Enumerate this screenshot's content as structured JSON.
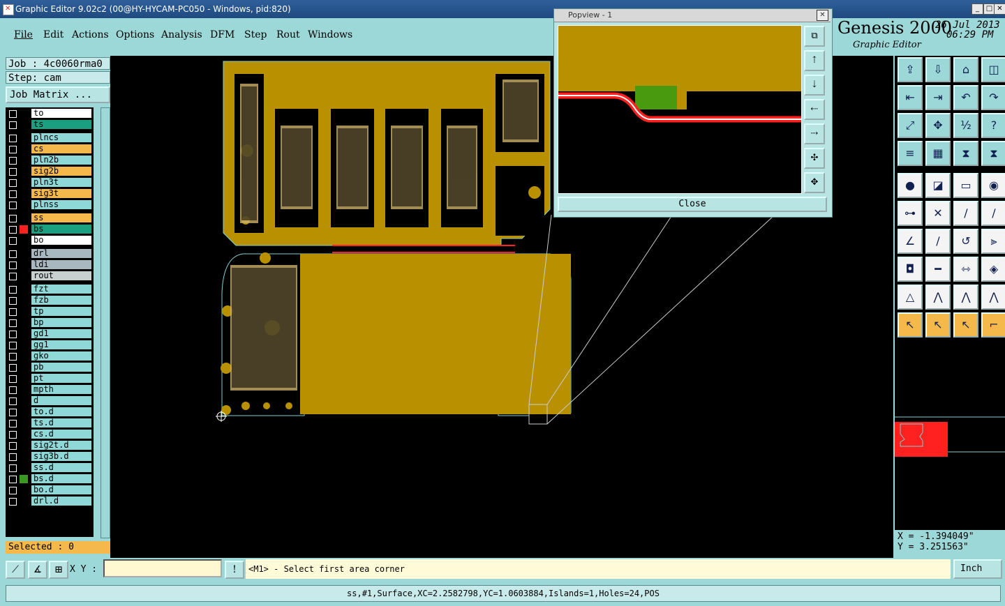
{
  "window": {
    "title": "Graphic Editor 9.02c2 (00@HY-HYCAM-PC050 - Windows, pid:820)",
    "min_label": "_",
    "max_label": "□",
    "close_label": "✕"
  },
  "menu": {
    "file": "File",
    "edit": "Edit",
    "actions": "Actions",
    "options": "Options",
    "analysis": "Analysis",
    "dfm": "DFM",
    "step": "Step",
    "rout": "Rout",
    "windows": "Windows"
  },
  "brand": {
    "name": "Genesis 2000",
    "subtitle": "Graphic Editor",
    "date": "26 Jul 2013",
    "time": "06:29 PM"
  },
  "left": {
    "job": "Job : 4c0060rma0",
    "step": "Step: cam",
    "job_matrix": "Job Matrix ...",
    "selected": "Selected : 0"
  },
  "layers": [
    {
      "name": "to",
      "bg": "#ffffff",
      "marker": ""
    },
    {
      "name": "ts",
      "bg": "#1aa080",
      "marker": ""
    },
    {
      "name": "plncs",
      "bg": "#8fd8d8",
      "marker": ""
    },
    {
      "name": "cs",
      "bg": "#f5b84a",
      "marker": ""
    },
    {
      "name": "pln2b",
      "bg": "#8fd8d8",
      "marker": ""
    },
    {
      "name": "sig2b",
      "bg": "#f5b84a",
      "marker": ""
    },
    {
      "name": "pln3t",
      "bg": "#8fd8d8",
      "marker": ""
    },
    {
      "name": "sig3t",
      "bg": "#f5b84a",
      "marker": ""
    },
    {
      "name": "plnss",
      "bg": "#8fd8d8",
      "marker": ""
    },
    {
      "name": "ss",
      "bg": "#f5b84a",
      "marker": ""
    },
    {
      "name": "bs",
      "bg": "#1aa080",
      "marker": "#ff2020"
    },
    {
      "name": "bo",
      "bg": "#ffffff",
      "marker": ""
    },
    {
      "name": "drl",
      "bg": "#a8b8c0",
      "marker": ""
    },
    {
      "name": "ldi",
      "bg": "#a8b8c0",
      "marker": ""
    },
    {
      "name": "rout",
      "bg": "#c8d0d0",
      "marker": ""
    },
    {
      "name": "fzt",
      "bg": "#8fd8d8",
      "marker": ""
    },
    {
      "name": "fzb",
      "bg": "#8fd8d8",
      "marker": ""
    },
    {
      "name": "tp",
      "bg": "#8fd8d8",
      "marker": ""
    },
    {
      "name": "bp",
      "bg": "#8fd8d8",
      "marker": ""
    },
    {
      "name": "gd1",
      "bg": "#8fd8d8",
      "marker": ""
    },
    {
      "name": "gg1",
      "bg": "#8fd8d8",
      "marker": ""
    },
    {
      "name": "gko",
      "bg": "#8fd8d8",
      "marker": ""
    },
    {
      "name": "pb",
      "bg": "#8fd8d8",
      "marker": ""
    },
    {
      "name": "pt",
      "bg": "#8fd8d8",
      "marker": ""
    },
    {
      "name": "mpth",
      "bg": "#8fd8d8",
      "marker": ""
    },
    {
      "name": "d",
      "bg": "#8fd8d8",
      "marker": ""
    },
    {
      "name": "to.d",
      "bg": "#8fd8d8",
      "marker": ""
    },
    {
      "name": "ts.d",
      "bg": "#8fd8d8",
      "marker": ""
    },
    {
      "name": "cs.d",
      "bg": "#8fd8d8",
      "marker": ""
    },
    {
      "name": "sig2t.d",
      "bg": "#8fd8d8",
      "marker": ""
    },
    {
      "name": "sig3b.d",
      "bg": "#8fd8d8",
      "marker": ""
    },
    {
      "name": "ss.d",
      "bg": "#8fd8d8",
      "marker": ""
    },
    {
      "name": "bs.d",
      "bg": "#8fd8d8",
      "marker": "#3a9a20"
    },
    {
      "name": "bo.d",
      "bg": "#8fd8d8",
      "marker": ""
    },
    {
      "name": "drl.d",
      "bg": "#8fd8d8",
      "marker": ""
    }
  ],
  "popview": {
    "title": "Popview - 1",
    "close_label": "Close",
    "close_x": "✕"
  },
  "bottom": {
    "xy_label": "X Y :",
    "xy_value": "",
    "prompt": "<M1> - Select first area corner",
    "units": "Inch",
    "status": "ss,#1,Surface,XC=2.2582798,YC=1.0603884,Islands=1,Holes=24,POS"
  },
  "coords": {
    "x": "X = -1.394049\"",
    "y": "Y = 3.251563\""
  },
  "colors": {
    "accent": "#9dd8d8",
    "copper": "#b89000",
    "highlight": "#f5b84a",
    "red": "#ff2020"
  },
  "tools": [
    "zoom-home-icon",
    "zoom-in-icon",
    "zoom-house-icon",
    "window-split-icon",
    "pan-left-icon",
    "pan-right-icon",
    "undo-view-icon",
    "redo-view-icon",
    "fit-icon",
    "center-icon",
    "scale-1-2-icon",
    "help-icon",
    "sliders-icon",
    "grid-icon",
    "snap-icon",
    "snap-red-icon",
    "feature-icon",
    "line-color-icon",
    "ruler-icon",
    "dot-icon",
    "node-icon",
    "cross-icon",
    "pad-arc-icon",
    "pad-line-icon",
    "draw-line-icon",
    "draw-line2-icon",
    "arc-icon",
    "flip-icon",
    "pad-add-icon",
    "line-add-icon",
    "measure-icon",
    "shapes-icon",
    "triangle-icon",
    "triangle2-icon",
    "triangle3-icon",
    "triangle4-icon",
    "select-arrow-icon",
    "select-arrow2-icon",
    "select-arrow3-icon",
    "select-route-icon"
  ]
}
